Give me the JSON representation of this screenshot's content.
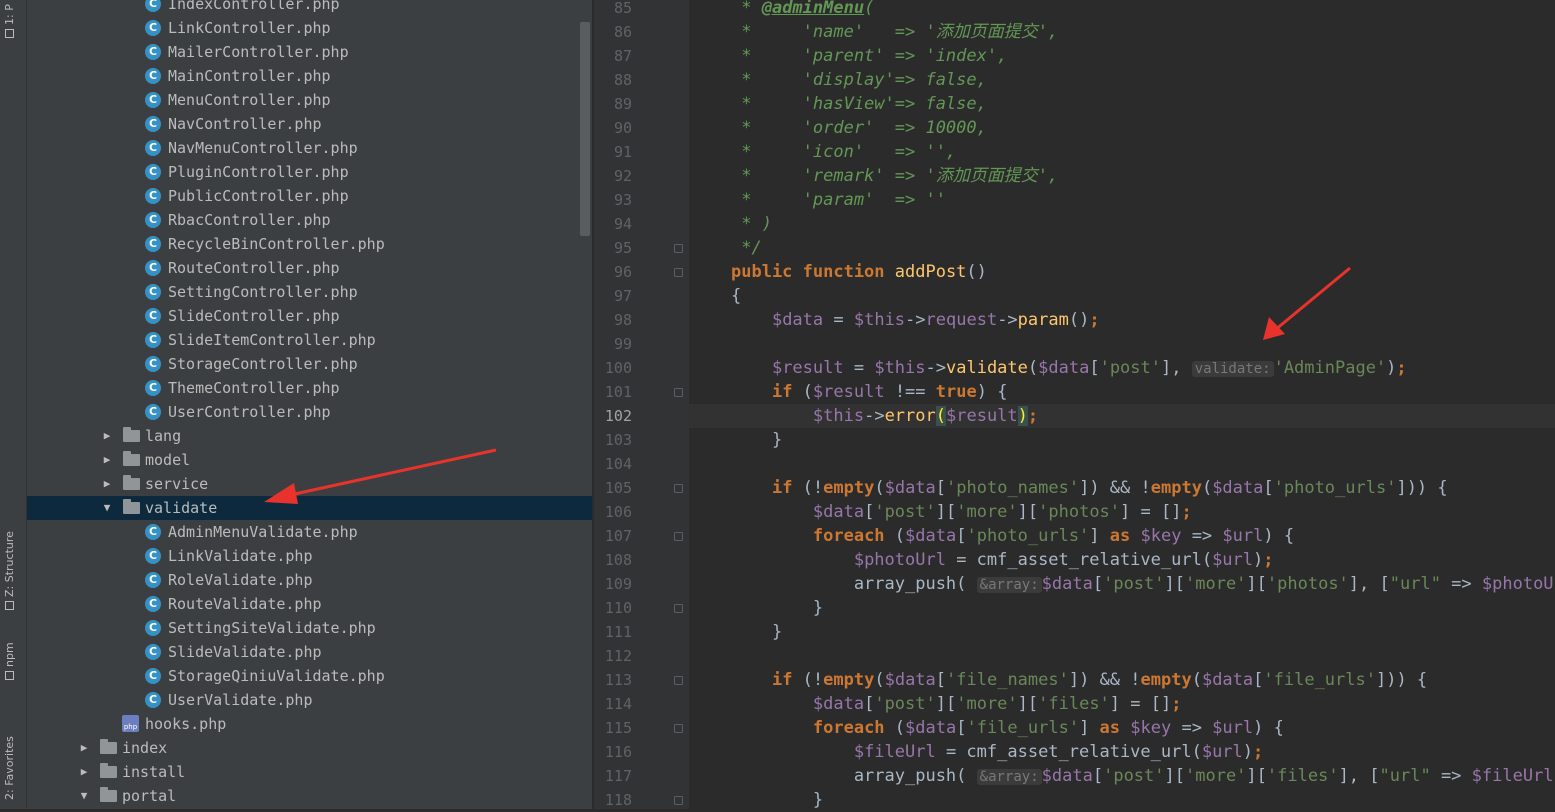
{
  "toolwindows": {
    "project": "1: P",
    "structure": "Z: Structure",
    "npm": "npm",
    "favorites": "2: Favorites"
  },
  "tree": {
    "rows": [
      {
        "type": "class",
        "label": "IndexController.php"
      },
      {
        "type": "class",
        "label": "LinkController.php"
      },
      {
        "type": "class",
        "label": "MailerController.php"
      },
      {
        "type": "class",
        "label": "MainController.php"
      },
      {
        "type": "class",
        "label": "MenuController.php"
      },
      {
        "type": "class",
        "label": "NavController.php"
      },
      {
        "type": "class",
        "label": "NavMenuController.php"
      },
      {
        "type": "class",
        "label": "PluginController.php"
      },
      {
        "type": "class",
        "label": "PublicController.php"
      },
      {
        "type": "class",
        "label": "RbacController.php"
      },
      {
        "type": "class",
        "label": "RecycleBinController.php"
      },
      {
        "type": "class",
        "label": "RouteController.php"
      },
      {
        "type": "class",
        "label": "SettingController.php"
      },
      {
        "type": "class",
        "label": "SlideController.php"
      },
      {
        "type": "class",
        "label": "SlideItemController.php"
      },
      {
        "type": "class",
        "label": "StorageController.php"
      },
      {
        "type": "class",
        "label": "ThemeController.php"
      },
      {
        "type": "class",
        "label": "UserController.php"
      },
      {
        "type": "folder",
        "label": "lang",
        "expanded": false
      },
      {
        "type": "folder",
        "label": "model",
        "expanded": false
      },
      {
        "type": "folder",
        "label": "service",
        "expanded": false
      },
      {
        "type": "folder",
        "label": "validate",
        "expanded": true,
        "selected": true
      },
      {
        "type": "class",
        "label": "AdminMenuValidate.php"
      },
      {
        "type": "class",
        "label": "LinkValidate.php"
      },
      {
        "type": "class",
        "label": "RoleValidate.php"
      },
      {
        "type": "class",
        "label": "RouteValidate.php"
      },
      {
        "type": "class",
        "label": "SettingSiteValidate.php"
      },
      {
        "type": "class",
        "label": "SlideValidate.php"
      },
      {
        "type": "class",
        "label": "StorageQiniuValidate.php"
      },
      {
        "type": "class",
        "label": "UserValidate.php"
      },
      {
        "type": "php",
        "label": "hooks.php"
      },
      {
        "type": "folder",
        "label": "index",
        "expanded": false
      },
      {
        "type": "folder",
        "label": "install",
        "expanded": false
      },
      {
        "type": "folder",
        "label": "portal",
        "expanded": true
      }
    ],
    "class_icon_letter": "C",
    "php_icon_text": "php"
  },
  "editor": {
    "current_line": 102,
    "lines": [
      {
        "n": "85",
        "t": [
          [
            "dc",
            " * "
          ],
          [
            "dct",
            "@adminMenu"
          ],
          [
            "dc",
            "("
          ]
        ]
      },
      {
        "n": "86",
        "t": [
          [
            "dc",
            " *     'name'   => '添加页面提交',"
          ]
        ]
      },
      {
        "n": "87",
        "t": [
          [
            "dc",
            " *     'parent' => 'index',"
          ]
        ]
      },
      {
        "n": "88",
        "t": [
          [
            "dc",
            " *     'display'=> false,"
          ]
        ]
      },
      {
        "n": "89",
        "t": [
          [
            "dc",
            " *     'hasView'=> false,"
          ]
        ]
      },
      {
        "n": "90",
        "t": [
          [
            "dc",
            " *     'order'  => 10000,"
          ]
        ]
      },
      {
        "n": "91",
        "t": [
          [
            "dc",
            " *     'icon'   => '',"
          ]
        ]
      },
      {
        "n": "92",
        "t": [
          [
            "dc",
            " *     'remark' => '添加页面提交',"
          ]
        ]
      },
      {
        "n": "93",
        "t": [
          [
            "dc",
            " *     'param'  => ''"
          ]
        ]
      },
      {
        "n": "94",
        "t": [
          [
            "dc",
            " * )"
          ]
        ]
      },
      {
        "n": "95",
        "t": [
          [
            "dc",
            " */"
          ]
        ]
      },
      {
        "n": "96",
        "t": [
          [
            "k",
            "public function "
          ],
          [
            "f",
            "addPost"
          ],
          [
            "p",
            "()"
          ]
        ]
      },
      {
        "n": "97",
        "t": [
          [
            "p",
            "{"
          ]
        ]
      },
      {
        "n": "98",
        "t": [
          [
            "p",
            "    "
          ],
          [
            "v",
            "$data"
          ],
          [
            "p",
            " = "
          ],
          [
            "v",
            "$this"
          ],
          [
            "p",
            "->"
          ],
          [
            "v",
            "request"
          ],
          [
            "p",
            "->"
          ],
          [
            "f",
            "param"
          ],
          [
            "p",
            "()"
          ],
          [
            "k",
            ";"
          ]
        ]
      },
      {
        "n": "99",
        "t": []
      },
      {
        "n": "100",
        "t": [
          [
            "p",
            "    "
          ],
          [
            "v",
            "$result"
          ],
          [
            "p",
            " = "
          ],
          [
            "v",
            "$this"
          ],
          [
            "p",
            "->"
          ],
          [
            "f",
            "validate"
          ],
          [
            "p",
            "("
          ],
          [
            "v",
            "$data"
          ],
          [
            "p",
            "["
          ],
          [
            "s",
            "'post'"
          ],
          [
            "p",
            "], "
          ],
          [
            "hint",
            "validate:"
          ],
          [
            "s",
            "'AdminPage'"
          ],
          [
            "p",
            ")"
          ],
          [
            "k",
            ";"
          ]
        ]
      },
      {
        "n": "101",
        "t": [
          [
            "p",
            "    "
          ],
          [
            "k",
            "if "
          ],
          [
            "p",
            "("
          ],
          [
            "v",
            "$result"
          ],
          [
            "p",
            " !== "
          ],
          [
            "k",
            "true"
          ],
          [
            "p",
            ") {"
          ]
        ]
      },
      {
        "n": "102",
        "t": [
          [
            "p",
            "        "
          ],
          [
            "v",
            "$this"
          ],
          [
            "p",
            "->"
          ],
          [
            "f",
            "error"
          ],
          [
            "brk",
            "("
          ],
          [
            "v",
            "$result"
          ],
          [
            "brk",
            ")"
          ],
          [
            "k",
            ";"
          ]
        ]
      },
      {
        "n": "103",
        "t": [
          [
            "p",
            "    }"
          ]
        ]
      },
      {
        "n": "104",
        "t": []
      },
      {
        "n": "105",
        "t": [
          [
            "p",
            "    "
          ],
          [
            "k",
            "if "
          ],
          [
            "p",
            "(!"
          ],
          [
            "k",
            "empty"
          ],
          [
            "p",
            "("
          ],
          [
            "v",
            "$data"
          ],
          [
            "p",
            "["
          ],
          [
            "s",
            "'photo_names'"
          ],
          [
            "p",
            "]) && !"
          ],
          [
            "k",
            "empty"
          ],
          [
            "p",
            "("
          ],
          [
            "v",
            "$data"
          ],
          [
            "p",
            "["
          ],
          [
            "s",
            "'photo_urls'"
          ],
          [
            "p",
            "])) {"
          ]
        ]
      },
      {
        "n": "106",
        "t": [
          [
            "p",
            "        "
          ],
          [
            "v",
            "$data"
          ],
          [
            "p",
            "["
          ],
          [
            "s",
            "'post'"
          ],
          [
            "p",
            "]["
          ],
          [
            "s",
            "'more'"
          ],
          [
            "p",
            "]["
          ],
          [
            "s",
            "'photos'"
          ],
          [
            "p",
            "] = []"
          ],
          [
            "k",
            ";"
          ]
        ]
      },
      {
        "n": "107",
        "t": [
          [
            "p",
            "        "
          ],
          [
            "k",
            "foreach "
          ],
          [
            "p",
            "("
          ],
          [
            "v",
            "$data"
          ],
          [
            "p",
            "["
          ],
          [
            "s",
            "'photo_urls'"
          ],
          [
            "p",
            "] "
          ],
          [
            "k",
            "as "
          ],
          [
            "v",
            "$key"
          ],
          [
            "p",
            " => "
          ],
          [
            "v",
            "$url"
          ],
          [
            "p",
            ") {"
          ]
        ]
      },
      {
        "n": "108",
        "t": [
          [
            "p",
            "            "
          ],
          [
            "v",
            "$photoUrl"
          ],
          [
            "p",
            " = cmf_asset_relative_url("
          ],
          [
            "v",
            "$url"
          ],
          [
            "p",
            ")"
          ],
          [
            "k",
            ";"
          ]
        ]
      },
      {
        "n": "109",
        "t": [
          [
            "p",
            "            array_push( "
          ],
          [
            "hint",
            "&array:"
          ],
          [
            "v",
            "$data"
          ],
          [
            "p",
            "["
          ],
          [
            "s",
            "'post'"
          ],
          [
            "p",
            "]["
          ],
          [
            "s",
            "'more'"
          ],
          [
            "p",
            "]["
          ],
          [
            "s",
            "'photos'"
          ],
          [
            "p",
            "], ["
          ],
          [
            "s",
            "\"url\""
          ],
          [
            "p",
            " => "
          ],
          [
            "v",
            "$photoUrl"
          ]
        ]
      },
      {
        "n": "110",
        "t": [
          [
            "p",
            "        }"
          ]
        ]
      },
      {
        "n": "111",
        "t": [
          [
            "p",
            "    }"
          ]
        ]
      },
      {
        "n": "112",
        "t": []
      },
      {
        "n": "113",
        "t": [
          [
            "p",
            "    "
          ],
          [
            "k",
            "if "
          ],
          [
            "p",
            "(!"
          ],
          [
            "k",
            "empty"
          ],
          [
            "p",
            "("
          ],
          [
            "v",
            "$data"
          ],
          [
            "p",
            "["
          ],
          [
            "s",
            "'file_names'"
          ],
          [
            "p",
            "]) && !"
          ],
          [
            "k",
            "empty"
          ],
          [
            "p",
            "("
          ],
          [
            "v",
            "$data"
          ],
          [
            "p",
            "["
          ],
          [
            "s",
            "'file_urls'"
          ],
          [
            "p",
            "])) {"
          ]
        ]
      },
      {
        "n": "114",
        "t": [
          [
            "p",
            "        "
          ],
          [
            "v",
            "$data"
          ],
          [
            "p",
            "["
          ],
          [
            "s",
            "'post'"
          ],
          [
            "p",
            "]["
          ],
          [
            "s",
            "'more'"
          ],
          [
            "p",
            "]["
          ],
          [
            "s",
            "'files'"
          ],
          [
            "p",
            "] = []"
          ],
          [
            "k",
            ";"
          ]
        ]
      },
      {
        "n": "115",
        "t": [
          [
            "p",
            "        "
          ],
          [
            "k",
            "foreach "
          ],
          [
            "p",
            "("
          ],
          [
            "v",
            "$data"
          ],
          [
            "p",
            "["
          ],
          [
            "s",
            "'file_urls'"
          ],
          [
            "p",
            "] "
          ],
          [
            "k",
            "as "
          ],
          [
            "v",
            "$key"
          ],
          [
            "p",
            " => "
          ],
          [
            "v",
            "$url"
          ],
          [
            "p",
            ") {"
          ]
        ]
      },
      {
        "n": "116",
        "t": [
          [
            "p",
            "            "
          ],
          [
            "v",
            "$fileUrl"
          ],
          [
            "p",
            " = cmf_asset_relative_url("
          ],
          [
            "v",
            "$url"
          ],
          [
            "p",
            ")"
          ],
          [
            "k",
            ";"
          ]
        ]
      },
      {
        "n": "117",
        "t": [
          [
            "p",
            "            array_push( "
          ],
          [
            "hint",
            "&array:"
          ],
          [
            "v",
            "$data"
          ],
          [
            "p",
            "["
          ],
          [
            "s",
            "'post'"
          ],
          [
            "p",
            "]["
          ],
          [
            "s",
            "'more'"
          ],
          [
            "p",
            "]["
          ],
          [
            "s",
            "'files'"
          ],
          [
            "p",
            "], ["
          ],
          [
            "s",
            "\"url\""
          ],
          [
            "p",
            " => "
          ],
          [
            "v",
            "$fileUrl"
          ]
        ]
      },
      {
        "n": "118",
        "t": [
          [
            "p",
            "        }"
          ]
        ]
      }
    ],
    "fold_markers": [
      "95",
      "96",
      "101",
      "105",
      "107",
      "110",
      "113",
      "115",
      "118"
    ]
  },
  "colors": {
    "annotation_arrow": "#e8332d",
    "selection": "#0d293e",
    "class_icon": "#3592c4"
  }
}
